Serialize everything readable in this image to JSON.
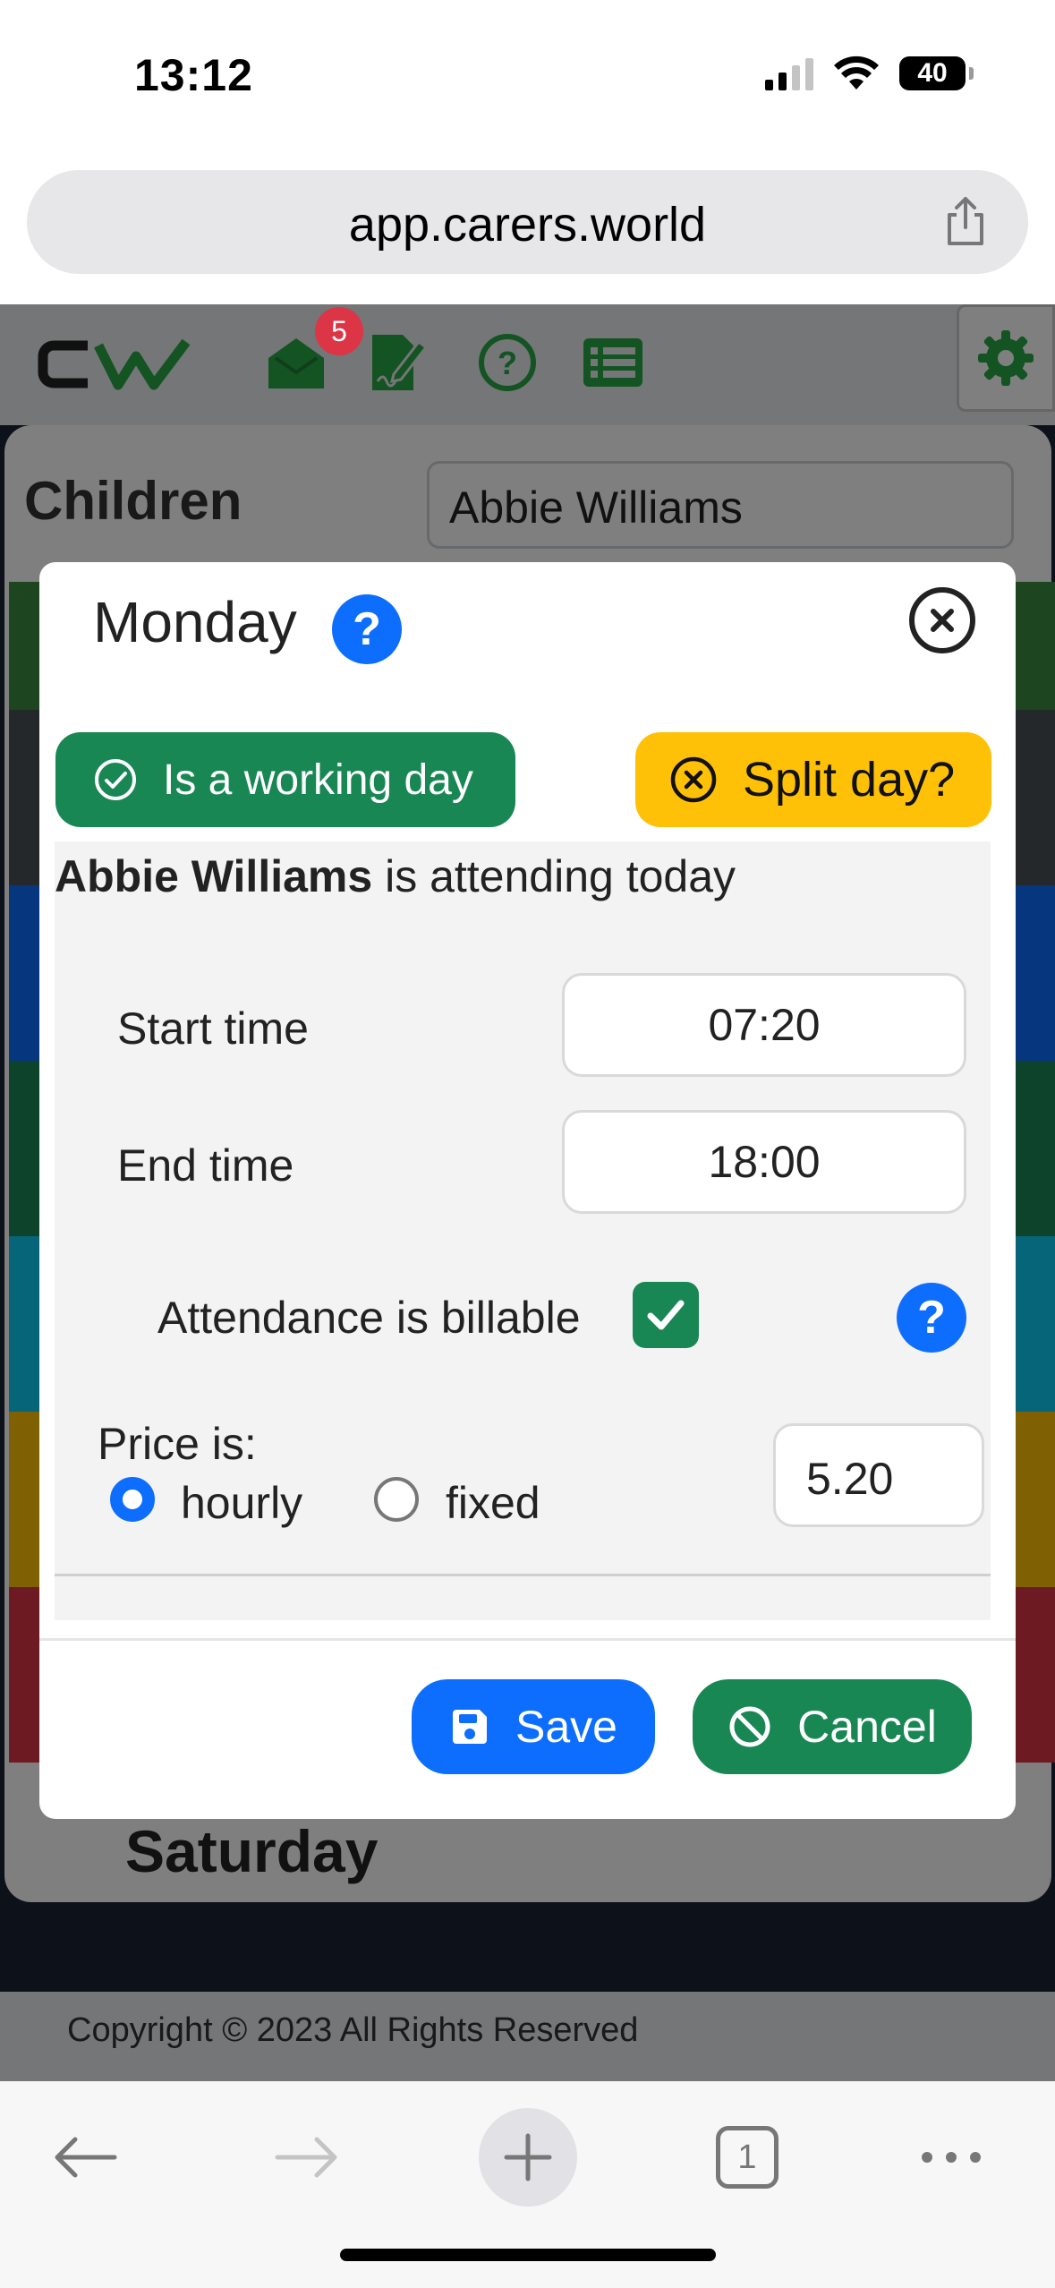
{
  "status_bar": {
    "time": "13:12",
    "battery": "40"
  },
  "browser": {
    "url": "app.carers.world",
    "tab_count": "1"
  },
  "header": {
    "notification_count": "5"
  },
  "background_page": {
    "children_label": "Children",
    "selected_child": "Abbie Williams",
    "day_label": "Saturday",
    "strip_colors": [
      "#3b8a3e",
      "#495057",
      "#0d6efd",
      "#198754",
      "#0dcaf0",
      "#ffc107",
      "#dc3545"
    ],
    "footer": "Copyright © 2023 All Rights Reserved"
  },
  "modal": {
    "title": "Monday",
    "working_day_label": "Is a working day",
    "split_day_label": "Split day?",
    "child_name": "Abbie Williams",
    "attending_text": " is attending today",
    "start_label": "Start time",
    "start_value": "07:20",
    "end_label": "End time",
    "end_value": "18:00",
    "billable_label": "Attendance is billable",
    "billable_checked": true,
    "price_label": "Price is:",
    "hourly_label": "hourly",
    "fixed_label": "fixed",
    "price_mode": "hourly",
    "price_value": "5.20",
    "save_label": "Save",
    "cancel_label": "Cancel"
  },
  "colors": {
    "primary": "#0d6efd",
    "success": "#198754",
    "warning": "#ffc107",
    "danger": "#dc3545",
    "brand_green": "#28a745"
  }
}
